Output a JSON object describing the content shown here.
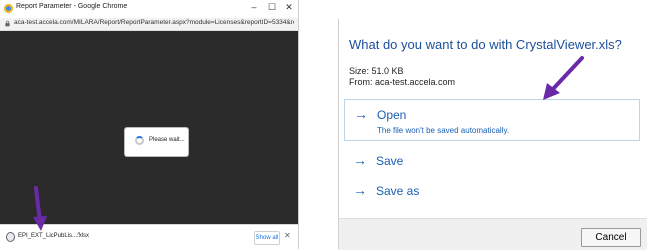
{
  "chrome_window": {
    "title": "Report Parameter - Google Chrome",
    "controls": {
      "minimize": "–",
      "maximize": "☐",
      "close": "✕"
    },
    "url": "aca-test.accela.com/MILARA/Report/ReportParameter.aspx?module=Licenses&reportID=5334&reportType=LINK_REP...",
    "loading_text": "Please wait...",
    "download_bar": {
      "file_name": "EPI_EXT_LicPubLis....xlsx",
      "chevron": "^",
      "show_all": "Show all",
      "close": "✕"
    }
  },
  "download_prompt": {
    "title": "What do you want to do with CrystalViewer.xls?",
    "size": "Size: 51.0 KB",
    "from": "From: aca-test.accela.com",
    "options": [
      {
        "arrow": "→",
        "label": "Open",
        "description": "The file won't be saved automatically."
      },
      {
        "arrow": "→",
        "label": "Save"
      },
      {
        "arrow": "→",
        "label": "Save as"
      }
    ],
    "cancel": "Cancel"
  },
  "colors": {
    "dialog_accent": "#1b5fb4",
    "annotation_arrow": "#6a2aa8",
    "page_background": "#2b2b2b"
  }
}
